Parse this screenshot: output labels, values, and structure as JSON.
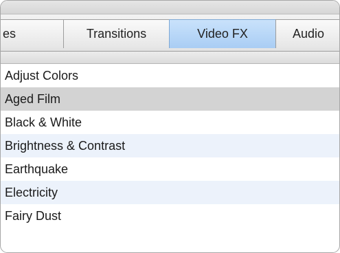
{
  "tabs": [
    {
      "label": "es",
      "active": false
    },
    {
      "label": "Transitions",
      "active": false
    },
    {
      "label": "Video FX",
      "active": true
    },
    {
      "label": "Audio",
      "active": false
    }
  ],
  "effects": [
    {
      "label": "Adjust Colors",
      "selected": false
    },
    {
      "label": "Aged Film",
      "selected": true
    },
    {
      "label": "Black & White",
      "selected": false
    },
    {
      "label": "Brightness & Contrast",
      "selected": false
    },
    {
      "label": "Earthquake",
      "selected": false
    },
    {
      "label": "Electricity",
      "selected": false
    },
    {
      "label": "Fairy Dust",
      "selected": false
    }
  ],
  "colors": {
    "active_tab": "#b7d6f7",
    "selection": "#d3d3d3",
    "alt_row": "#ecf2fb"
  }
}
